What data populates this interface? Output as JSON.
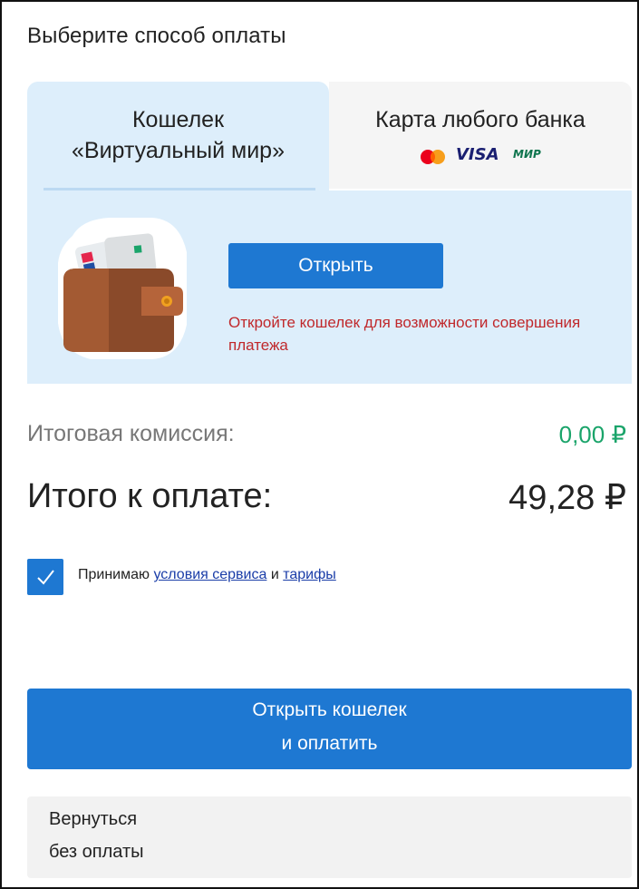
{
  "title": "Выберите способ оплаты",
  "tabs": {
    "wallet": {
      "line1": "Кошелек",
      "line2": "«Виртуальный мир»",
      "active": true
    },
    "card": {
      "line1": "Карта любого банка",
      "logos": [
        "mastercard-logo",
        "visa-logo",
        "mir-logo"
      ],
      "visa_text": "VISA",
      "mir_text": "МИР"
    }
  },
  "wallet_panel": {
    "open_button": "Открыть",
    "warning": "Откройте кошелек для возможности совершения платежа"
  },
  "summary": {
    "commission_label": "Итоговая комиссия:",
    "commission_value": "0,00 ₽",
    "total_label": "Итого к оплате:",
    "total_value": "49,28 ₽"
  },
  "consent": {
    "checked": true,
    "prefix": "Принимаю",
    "terms_link": "условия сервиса",
    "and": "и",
    "tariffs_link": "тарифы"
  },
  "pay_button": {
    "line1": "Открыть кошелек",
    "line2": "и оплатить"
  },
  "back_button": {
    "line1": "Вернуться",
    "line2": "без оплаты"
  },
  "colors": {
    "accent": "#1e78d2",
    "panel_bg": "#ddeefb",
    "warning": "#c0282b",
    "commission": "#1aa46a"
  }
}
